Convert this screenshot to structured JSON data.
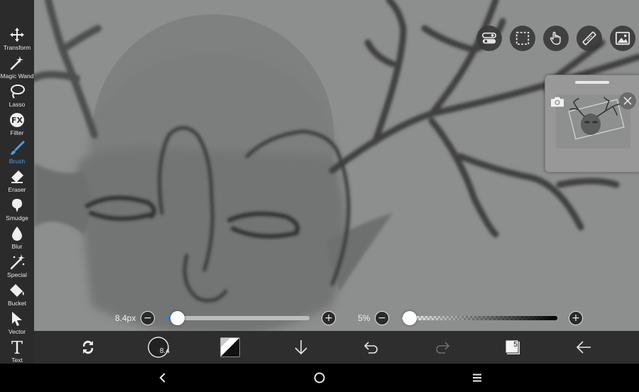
{
  "toolbar": {
    "tools": [
      {
        "label": "Transform",
        "icon": "move-arrows-icon"
      },
      {
        "label": "Magic Wand",
        "icon": "magic-wand-icon"
      },
      {
        "label": "Lasso",
        "icon": "lasso-icon"
      },
      {
        "label": "Filter",
        "icon": "fx-icon"
      },
      {
        "label": "Brush",
        "icon": "brush-icon",
        "active": true
      },
      {
        "label": "Eraser",
        "icon": "eraser-icon"
      },
      {
        "label": "Smudge",
        "icon": "smudge-finger-icon"
      },
      {
        "label": "Blur",
        "icon": "droplet-icon"
      },
      {
        "label": "Special",
        "icon": "sparkle-wand-icon"
      },
      {
        "label": "Bucket",
        "icon": "paint-bucket-icon"
      },
      {
        "label": "Vector",
        "icon": "cursor-arrow-icon"
      },
      {
        "label": "Text",
        "icon": "text-t-icon"
      }
    ],
    "active_color": "#4a9fe8"
  },
  "top_buttons": [
    "toggle-settings-icon",
    "selection-rect-icon",
    "hand-pan-icon",
    "ruler-icon",
    "image-reference-icon"
  ],
  "navigator": {
    "camera": "camera-icon",
    "close": "close-icon"
  },
  "size_slider": {
    "label": "8.4px",
    "value_fraction": 0.08,
    "accent": "#3a7bd5"
  },
  "opacity_slider": {
    "label": "5%",
    "value_fraction": 0.05
  },
  "bottom_bar": {
    "brush_size": "8.4",
    "layer_count": "5",
    "items": [
      "swap-colors-icon",
      "brush-size-circle",
      "color-swatch-icon",
      "arrow-down-icon",
      "undo-icon",
      "redo-icon",
      "layers-icon",
      "back-arrow-icon"
    ]
  },
  "system_nav": [
    "back-chevron-icon",
    "home-circle-icon",
    "menu-lines-icon"
  ]
}
